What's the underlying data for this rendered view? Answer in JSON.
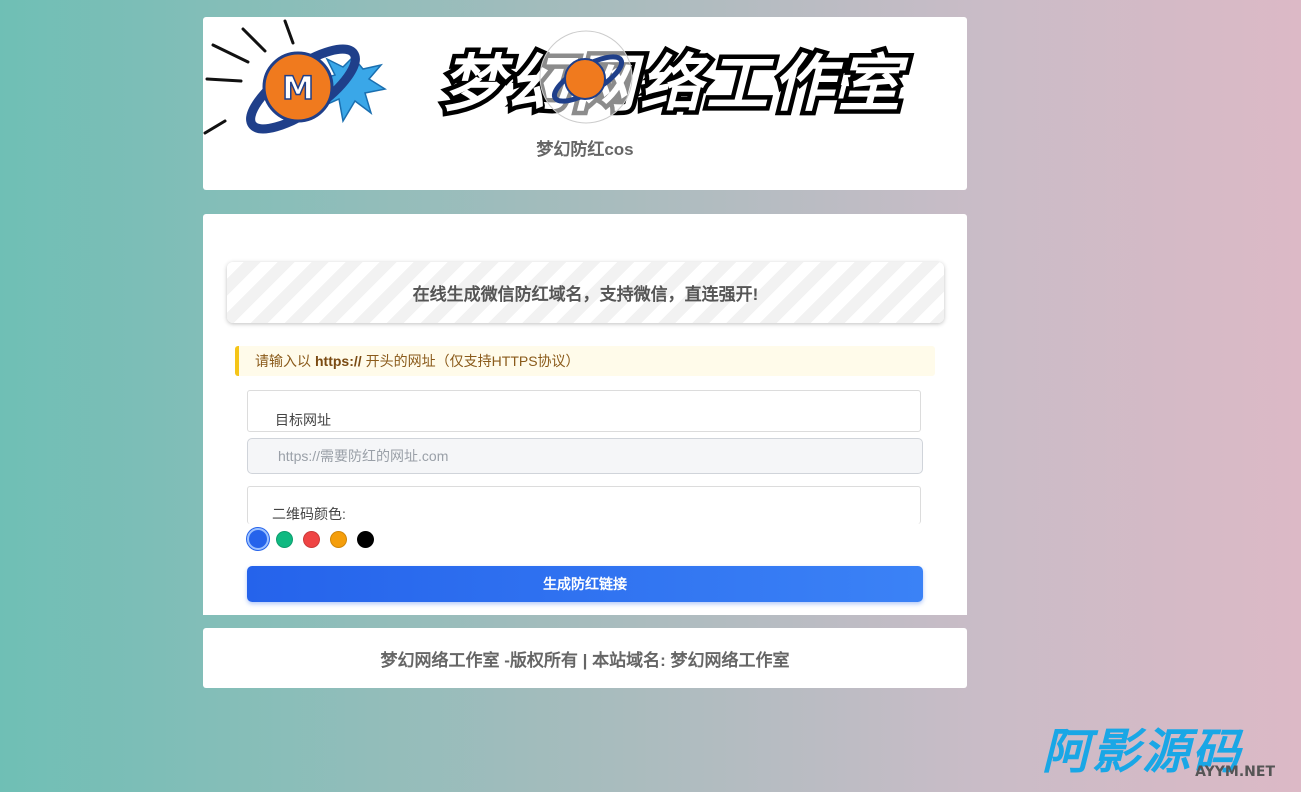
{
  "header": {
    "banner_text": "梦幻网络工作室",
    "site_title": "梦幻防红cos"
  },
  "main": {
    "headline": "在线生成微信防红域名，支持微信，直连强开!",
    "notice": {
      "prefix": "请输入以",
      "emphasis": "https://",
      "suffix": "开头的网址（仅支持HTTPS协议）"
    },
    "url_label": "目标网址",
    "url_placeholder": "https://需要防红的网址.com",
    "url_value": "",
    "color_label": "二维码颜色:",
    "colors": [
      "#2563eb",
      "#10b981",
      "#ef4444",
      "#f59e0b",
      "#000000"
    ],
    "selected_color": "#2563eb",
    "generate_label": "生成防红链接"
  },
  "footer": {
    "text": "梦幻网络工作室 -版权所有 | 本站域名: 梦幻网络工作室"
  },
  "watermark": {
    "main_text": "阿影源码",
    "sub_text": "AYYM.NET"
  }
}
